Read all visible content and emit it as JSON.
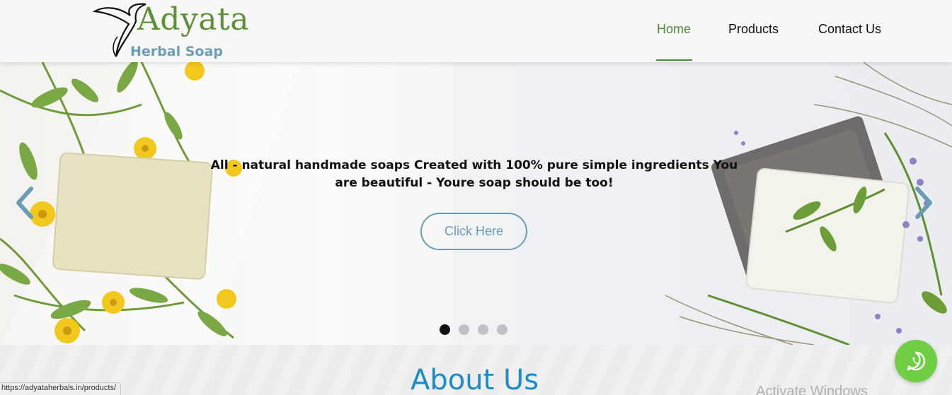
{
  "brand": {
    "name": "Adyata",
    "tagline": "Herbal Soap",
    "colors": {
      "green": "#5e8f3b",
      "blue": "#6b9db5",
      "accent": "#1b8cc8"
    }
  },
  "nav": {
    "items": [
      {
        "label": "Home",
        "active": true
      },
      {
        "label": "Products",
        "active": false
      },
      {
        "label": "Contact Us",
        "active": false
      }
    ]
  },
  "hero": {
    "headline": "All - natural handmade soaps Created with 100% pure simple ingredients You are beautiful - Youre soap should be too!",
    "button_label": "Click Here",
    "prev_icon": "chevron-left-icon",
    "next_icon": "chevron-right-icon",
    "slide_count": 4,
    "active_slide": 1
  },
  "about": {
    "title": "About Us"
  },
  "overlay": {
    "activate_text": "Activate Windows",
    "status_url": "https://adyataherbals.in/products/",
    "whatsapp_icon": "whatsapp-icon"
  }
}
